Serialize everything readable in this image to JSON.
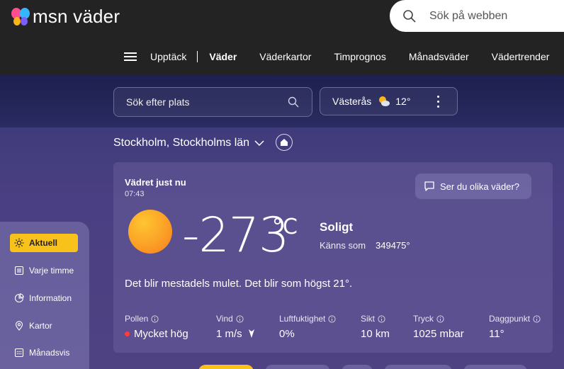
{
  "header": {
    "logo_text": "msn väder",
    "search_placeholder": "Sök på webben",
    "nav": {
      "items": [
        "Upptäck",
        "Väder",
        "Väderkartor",
        "Timprognos",
        "Månadsväder",
        "Vädertrender"
      ],
      "active_index": 1
    }
  },
  "location_bar": {
    "search_placeholder": "Sök efter plats",
    "saved_location": {
      "name": "Västerås",
      "temp": "12°"
    }
  },
  "location": {
    "title": "Stockholm, Stockholms län"
  },
  "current": {
    "title": "Vädret just nu",
    "time": "07:43",
    "feedback_label": "Ser du olika väder?",
    "temperature": "-273",
    "unit": "°C",
    "condition": "Soligt",
    "feels_like_label": "Känns som",
    "feels_like_value": "349475°",
    "summary": "Det blir mestadels mulet. Det blir som högst 21°.",
    "metrics": [
      {
        "label": "Pollen",
        "value": "Mycket hög"
      },
      {
        "label": "Vind",
        "value": "1 m/s"
      },
      {
        "label": "Luftfuktighet",
        "value": "0%"
      },
      {
        "label": "Sikt",
        "value": "10 km"
      },
      {
        "label": "Tryck",
        "value": "1025 mbar"
      },
      {
        "label": "Daggpunkt",
        "value": "11°"
      }
    ]
  },
  "sidebar": {
    "items": [
      "Aktuell",
      "Varje timme",
      "Information",
      "Kartor",
      "Månadsvis"
    ],
    "active_index": 0
  },
  "colors": {
    "accent": "#f9c21b",
    "alert": "#ff3b3b",
    "sun_center": "#ffc531",
    "sun_edge": "#f57c1e"
  }
}
